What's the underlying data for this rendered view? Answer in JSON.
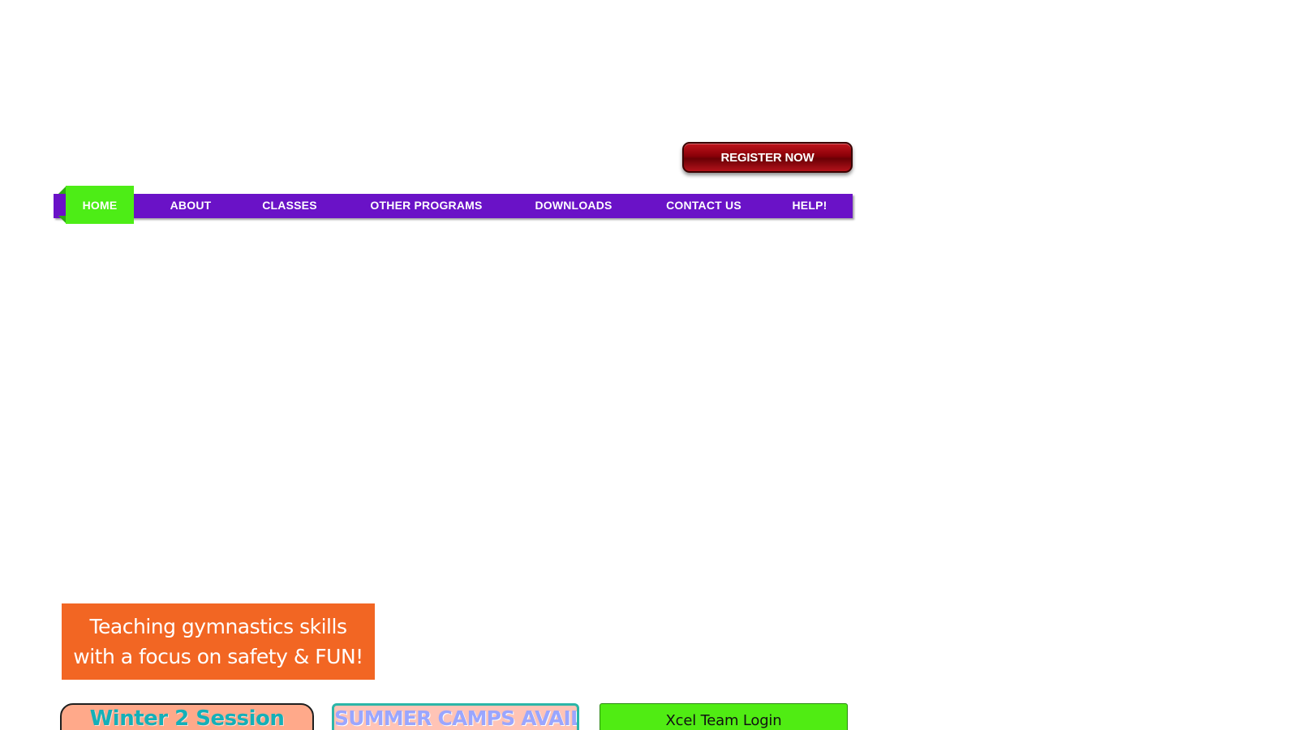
{
  "header": {
    "register_label": "REGISTER NOW"
  },
  "nav": {
    "items": [
      {
        "label": "HOME",
        "active": true
      },
      {
        "label": "ABOUT",
        "active": false
      },
      {
        "label": "CLASSES",
        "active": false
      },
      {
        "label": "OTHER PROGRAMS",
        "active": false
      },
      {
        "label": "DOWNLOADS",
        "active": false
      },
      {
        "label": "CONTACT US",
        "active": false
      },
      {
        "label": "HELP!",
        "active": false
      }
    ]
  },
  "main": {
    "tagline": "Teaching gymnastics skills with a focus on safety & FUN!",
    "cards": {
      "winter": {
        "title": "Winter 2 Session"
      },
      "summer": {
        "title": "SUMMER CAMPS AVAILABLE"
      },
      "xcel": {
        "title": "Xcel Team Login"
      }
    }
  },
  "colors": {
    "nav_bar": "#6a12c7",
    "nav_active": "#4ded16",
    "register": "#a00c14",
    "tagline_bg": "#f26623",
    "winter_bg": "#ffa98a",
    "winter_text": "#14b0b8",
    "summer_bg": "#ffc4b6",
    "summer_text": "#9aa6ff",
    "xcel_bg": "#50ec13"
  }
}
